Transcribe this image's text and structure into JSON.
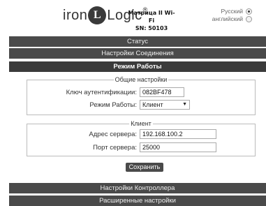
{
  "header": {
    "logo_left": "iron",
    "logo_mid": "L",
    "logo_right": "Logic",
    "logo_reg": "®",
    "device_name": "Матрица II Wi-Fi",
    "serial": "SN: 50103",
    "languages": [
      {
        "label": "Русский",
        "selected": true
      },
      {
        "label": "английский",
        "selected": false
      }
    ]
  },
  "menu": {
    "status": "Статус",
    "connection_settings": "Настройки Соединения",
    "work_mode": "Режим Работы",
    "controller_settings": "Настройки Контроллера",
    "advanced_settings": "Расширенные настройки"
  },
  "general": {
    "legend": "Общие настройки",
    "auth_key_label": "Ключ аутентификации:",
    "auth_key_value": "082BF478",
    "mode_label": "Режим Работы:",
    "mode_value": "Клиент"
  },
  "client": {
    "legend": "Клиент",
    "server_address_label": "Адрес сервера:",
    "server_address_value": "192.168.100.2",
    "server_port_label": "Порт сервера:",
    "server_port_value": "25000"
  },
  "actions": {
    "save": "Сохранить"
  }
}
